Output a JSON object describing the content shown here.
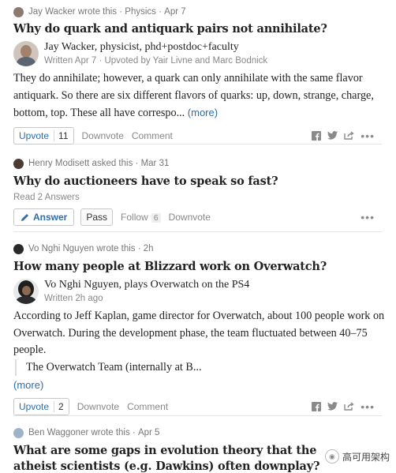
{
  "feed": [
    {
      "meta": {
        "author": "Jay Wacker",
        "action": "wrote this",
        "topic": "Physics",
        "date": "Apr 7"
      },
      "title": "Why do quark and antiquark pairs not annihilate?",
      "author": {
        "name": "Jay Wacker, physicist, phd+postdoc+faculty",
        "sub": "Written Apr 7 · Upvoted by Yair Livne and Marc Bodnick"
      },
      "body": "They do annihilate; however, a quark can only annihilate with the same flavor antiquark. So there are six different flavors of quarks: up, down, strange, charge, bottom, top. These all have correspo...",
      "more": "(more)",
      "upvote": {
        "label": "Upvote",
        "count": "11"
      },
      "downvote": "Downvote",
      "comment": "Comment"
    },
    {
      "meta": {
        "author": "Henry Modisett",
        "action": "asked this",
        "date": "Mar 31"
      },
      "title": "Why do auctioneers have to speak so fast?",
      "read_answers": "Read 2 Answers",
      "answer": "Answer",
      "pass": "Pass",
      "follow": {
        "label": "Follow",
        "count": "6"
      },
      "downvote": "Downvote"
    },
    {
      "meta": {
        "author": "Vo Nghi Nguyen",
        "action": "wrote this",
        "date": "2h"
      },
      "title": "How many people at Blizzard work on Overwatch?",
      "author": {
        "name": "Vo Nghi Nguyen, plays Overwatch on the PS4",
        "sub": "Written 2h ago"
      },
      "body": "According to Jeff Kaplan, game director for Overwatch, about 100 people work on Overwatch. During the development phase, the team fluctuated between 40–75 people.",
      "quote": "The Overwatch Team (internally at B...",
      "more": "(more)",
      "upvote": {
        "label": "Upvote",
        "count": "2"
      },
      "downvote": "Downvote",
      "comment": "Comment"
    },
    {
      "meta": {
        "author": "Ben Waggoner",
        "action": "wrote this",
        "date": "Apr 5"
      },
      "title": "What are some gaps in evolution theory that the atheist scientists (e.g. Dawkins) often downplay?"
    }
  ],
  "watermark": "高可用架构",
  "colors": {
    "link": "#2b6dad",
    "title": "#222222",
    "meta": "#777777"
  }
}
